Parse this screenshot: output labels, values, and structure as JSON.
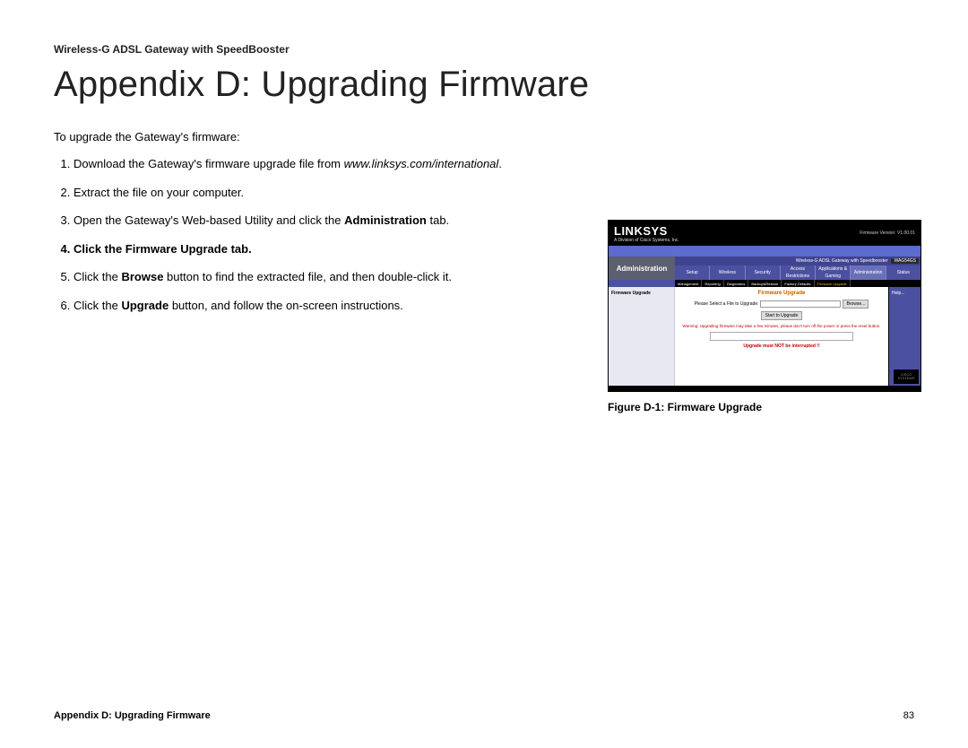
{
  "header": {
    "product": "Wireless-G ADSL Gateway with SpeedBooster",
    "title": "Appendix D: Upgrading Firmware"
  },
  "body": {
    "intro": "To upgrade the Gateway's firmware:",
    "steps": {
      "s1a": "Download the Gateway's firmware upgrade file from ",
      "s1b": "www.linksys.com/international",
      "s1c": ".",
      "s2": "Extract the file on your computer.",
      "s3a": "Open the Gateway's Web-based Utility and click the ",
      "s3b": "Administration",
      "s3c": " tab.",
      "s4a": "Click the ",
      "s4b": "Firmware Upgrade",
      "s4c": " tab.",
      "s5a": "Click the ",
      "s5b": "Browse",
      "s5c": " button to find the extracted file, and then double-click it.",
      "s6a": "Click the ",
      "s6b": "Upgrade",
      "s6c": " button, and follow the on-screen instructions."
    }
  },
  "figure": {
    "logo": "LINKSYS",
    "logo_sub": "A Division of Cisco Systems, Inc.",
    "firmware_version": "Firmware Version: V1.00.01",
    "product_name": "Wireless-G ADSL Gateway with Speedbooster",
    "model": "WAG54GS",
    "admin": "Administration",
    "tabs1": [
      "Setup",
      "Wireless",
      "Security",
      "Access Restrictions",
      "Applications & Gaming",
      "Administration",
      "Status"
    ],
    "tabs2": [
      "Management",
      "Reporting",
      "Diagnostics",
      "Backup&Restore",
      "Factory Defaults",
      "Firmware Upgrade"
    ],
    "side_label": "Firmware Upgrade",
    "inner_title": "Firmware Upgrade",
    "file_label": "Please Select a File to Upgrade:",
    "browse_btn": "Browse...",
    "start_btn": "Start to Upgrade",
    "warning": "Warning: Upgrading firmware may take a few minutes, please don't turn off the power or press the reset button.",
    "interrupt": "Upgrade must NOT be interrupted !!",
    "help": "Help...",
    "cisco": "CISCO SYSTEMS",
    "caption": "Figure D-1: Firmware Upgrade"
  },
  "footer": {
    "left": "Appendix D: Upgrading Firmware",
    "right": "83"
  }
}
